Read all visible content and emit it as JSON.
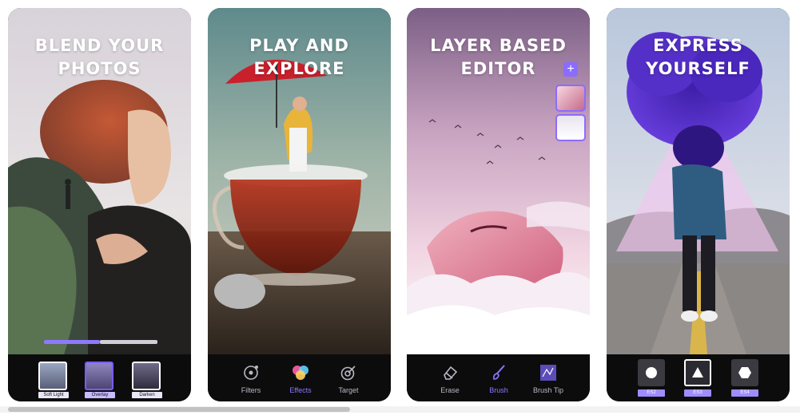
{
  "screens": [
    {
      "headline": [
        "BLEND YOUR",
        "PHOTOS"
      ],
      "blend_modes": [
        {
          "label": "Soft Light",
          "selected": false
        },
        {
          "label": "Overlay",
          "selected": true
        },
        {
          "label": "Darken",
          "selected": false
        }
      ],
      "opacity_level": 0.5
    },
    {
      "headline": [
        "PLAY AND",
        "EXPLORE"
      ],
      "tools": [
        {
          "label": "Filters",
          "icon": "filters-icon",
          "active": false
        },
        {
          "label": "Effects",
          "icon": "effects-icon",
          "active": true
        },
        {
          "label": "Target",
          "icon": "target-icon",
          "active": false
        }
      ]
    },
    {
      "headline": [
        "LAYER BASED",
        "EDITOR"
      ],
      "layer_add_label": "+",
      "tools": [
        {
          "label": "Erase",
          "icon": "eraser-icon",
          "active": false
        },
        {
          "label": "Brush",
          "icon": "brush-icon",
          "active": true
        },
        {
          "label": "Brush Tip",
          "icon": "brush-tip-icon",
          "active": false
        }
      ]
    },
    {
      "headline": [
        "EXPRESS",
        "YOURSELF"
      ],
      "shapes": [
        {
          "label": "ES2",
          "icon": "circle-icon",
          "selected": false
        },
        {
          "label": "ES3",
          "icon": "triangle-icon",
          "selected": true
        },
        {
          "label": "ES4",
          "icon": "hexagon-icon",
          "selected": false
        }
      ]
    }
  ],
  "colors": {
    "accent": "#8f78ff",
    "toolbar_bg": "#0c0c0d"
  }
}
